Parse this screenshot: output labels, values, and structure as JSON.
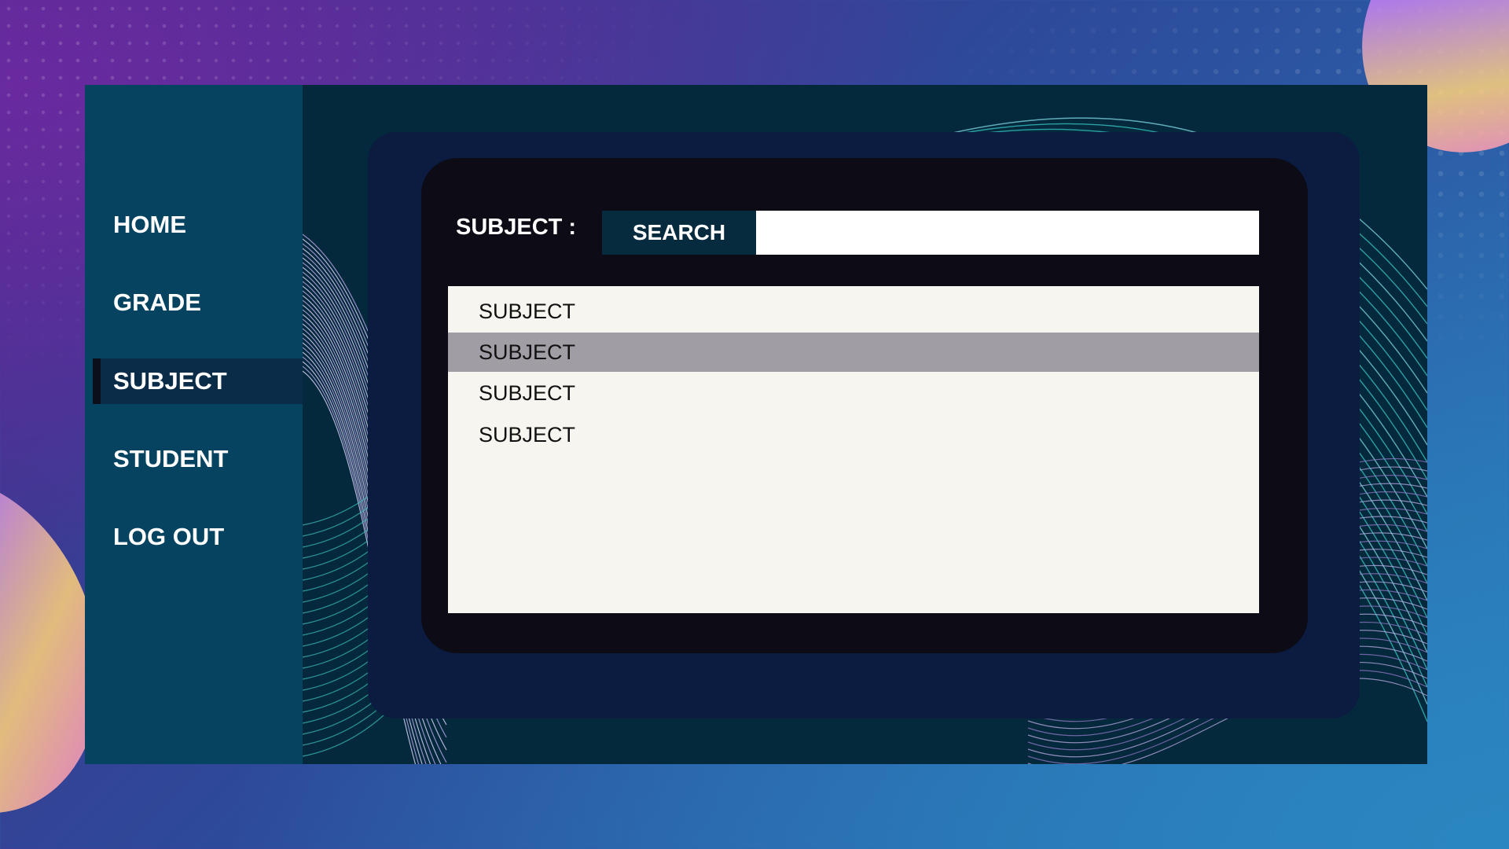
{
  "sidebar": {
    "items": [
      {
        "label": "HOME",
        "active": false
      },
      {
        "label": "GRADE",
        "active": false
      },
      {
        "label": "SUBJECT",
        "active": true
      },
      {
        "label": "STUDENT",
        "active": false
      },
      {
        "label": "LOG OUT",
        "active": false
      }
    ]
  },
  "search": {
    "label": "SUBJECT :",
    "button_label": "SEARCH",
    "value": "",
    "placeholder": ""
  },
  "list": {
    "items": [
      "SUBJECT",
      "SUBJECT",
      "SUBJECT",
      "SUBJECT"
    ],
    "selected_index": 1
  },
  "colors": {
    "sidebar": "#064360",
    "window": "#04283c",
    "panel": "#0d0b15",
    "list_background": "#f6f5ef",
    "selected_row": "#a09da4"
  }
}
